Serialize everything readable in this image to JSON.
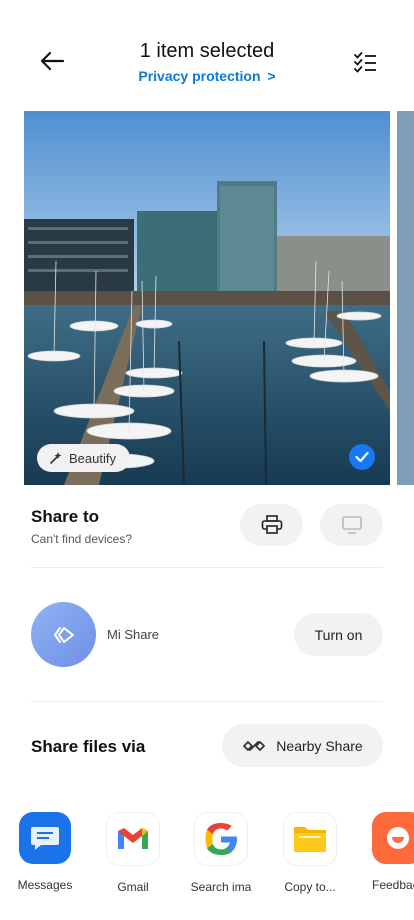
{
  "header": {
    "title": "1 item selected",
    "subtitle": "Privacy protection",
    "subtitle_chevron": ">",
    "back_icon": "back-arrow-icon",
    "select_all_icon": "checklist-icon"
  },
  "photo": {
    "beautify_label": "Beautify",
    "selected": true
  },
  "share_to": {
    "title": "Share to",
    "subtitle": "Can't find devices?",
    "print_icon": "printer-icon",
    "cast_icon": "monitor-icon"
  },
  "mi_share": {
    "label": "Mi Share",
    "button": "Turn on"
  },
  "share_files": {
    "title": "Share files via",
    "nearby_label": "Nearby Share"
  },
  "apps": [
    {
      "label": "Messages",
      "icon": "messages-icon"
    },
    {
      "label": "Gmail",
      "icon": "gmail-icon"
    },
    {
      "label": "Search ima",
      "icon": "google-icon"
    },
    {
      "label": "Copy to...",
      "icon": "folder-icon"
    },
    {
      "label": "Feedbac",
      "icon": "feedback-icon"
    }
  ],
  "colors": {
    "accent": "#0a7bd8",
    "check": "#1877f2"
  }
}
